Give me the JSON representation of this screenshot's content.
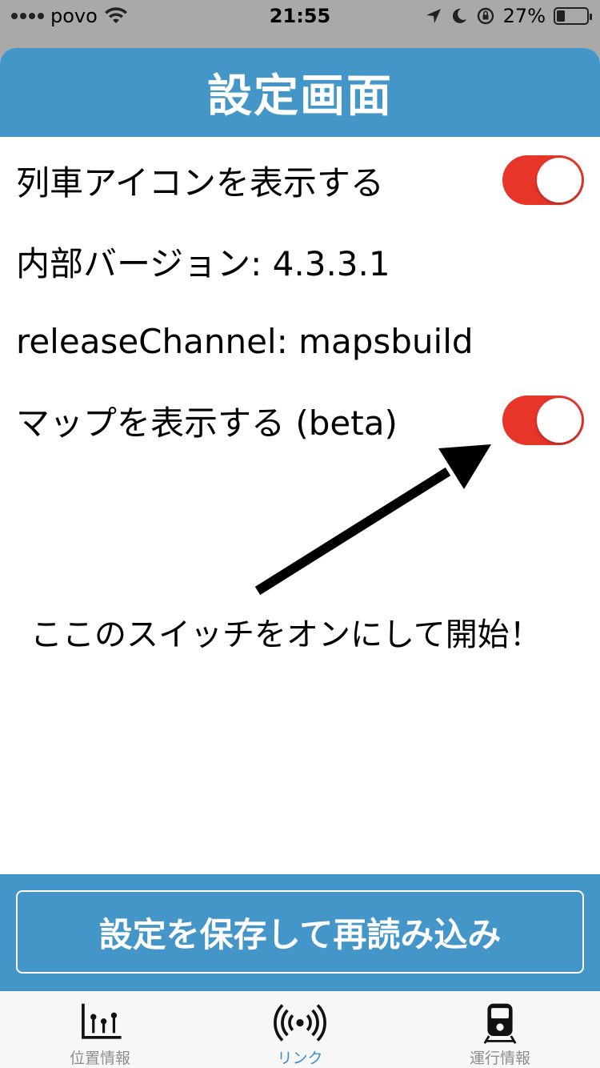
{
  "status_bar": {
    "carrier": "povo",
    "time": "21:55",
    "battery_percent": "27%",
    "battery_level": 0.27
  },
  "header": {
    "title": "設定画面"
  },
  "settings": {
    "show_train_icon": {
      "label": "列車アイコンを表示する",
      "on": true
    },
    "internal_version": "内部バージョン: 4.3.3.1",
    "release_channel": "releaseChannel: mapsbuild",
    "show_map": {
      "label": "マップを表示する (beta)",
      "on": true
    }
  },
  "annotation": {
    "text": "ここのスイッチをオンにして開始！"
  },
  "save_button": {
    "label": "設定を保存して再読み込み"
  },
  "tabs": [
    {
      "label": "位置情報",
      "icon": "location-chart-icon",
      "active": false
    },
    {
      "label": "リンク",
      "icon": "broadcast-icon",
      "active": true
    },
    {
      "label": "運行情報",
      "icon": "train-icon",
      "active": false
    }
  ],
  "colors": {
    "header_blue": "#4596c8",
    "toggle_red": "#e8352a",
    "tab_active": "#3d8fd1",
    "tab_inactive": "#8e8e8e"
  }
}
